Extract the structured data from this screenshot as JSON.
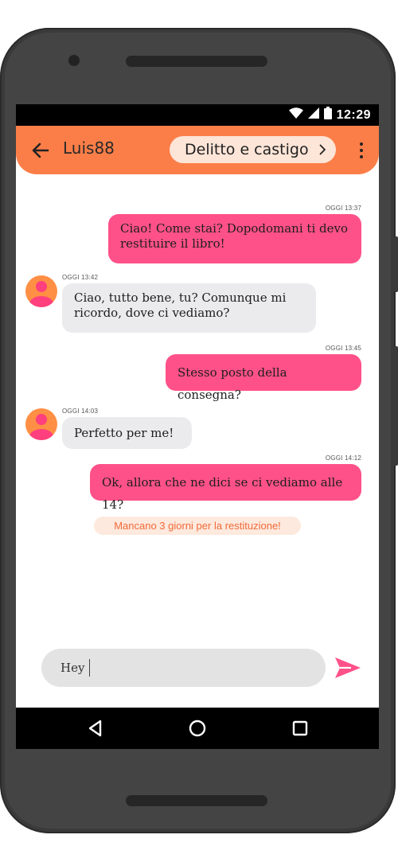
{
  "status_bar": {
    "time": "12:29"
  },
  "header": {
    "username": "Luis88",
    "book_title": "Delitto e castigo"
  },
  "messages": [
    {
      "direction": "out",
      "timestamp": "OGGI 13:37",
      "text": "Ciao! Come stai? Dopodomani ti devo restituire il libro!"
    },
    {
      "direction": "in",
      "timestamp": "OGGI 13:42",
      "text": "Ciao, tutto bene, tu? Comunque mi ricordo, dove ci vediamo?"
    },
    {
      "direction": "out",
      "timestamp": "OGGI 13:45",
      "text": "Stesso posto della consegna?"
    },
    {
      "direction": "in",
      "timestamp": "OGGI 14:03",
      "text": "Perfetto per me!"
    },
    {
      "direction": "out",
      "timestamp": "OGGI 14:12",
      "text": "Ok, allora che ne dici se ci vediamo alle 14?"
    }
  ],
  "notice": "Mancano 3 giorni per la restituzione!",
  "composer": {
    "value": "Hey"
  },
  "icons": {
    "back": "arrow-left-icon",
    "chevron": "chevron-right-icon",
    "more": "more-vertical-icon",
    "send": "send-icon",
    "avatar": "user-avatar-icon"
  },
  "colors": {
    "primary": "#fb7e48",
    "outgoing_bubble": "#ff5189",
    "incoming_bubble": "#ebebed",
    "chip_bg": "#fde5d7",
    "notice_bg": "#fde9dd",
    "notice_text": "#f26a3a"
  }
}
